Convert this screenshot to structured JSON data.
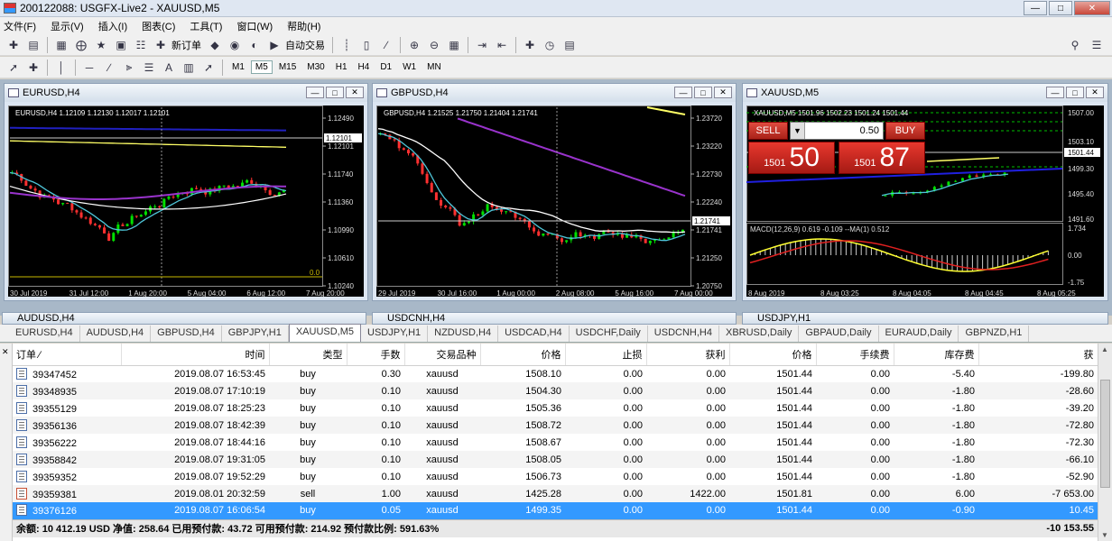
{
  "window": {
    "title": "200122088: USGFX-Live2 - XAUUSD,M5"
  },
  "menu": [
    "文件(F)",
    "显示(V)",
    "插入(I)",
    "图表(C)",
    "工具(T)",
    "窗口(W)",
    "帮助(H)"
  ],
  "toolbar": {
    "new_order": "新订单",
    "auto_trade": "自动交易"
  },
  "timeframes": [
    "M1",
    "M5",
    "M15",
    "M30",
    "H1",
    "H4",
    "D1",
    "W1",
    "MN"
  ],
  "active_timeframe": "M5",
  "charts": [
    {
      "title": "EURUSD,H4",
      "info": "EURUSD,H4  1.12109 1.12130 1.12017 1.12101",
      "price_labels": [
        "1.12490",
        "1.12101",
        "1.11740",
        "1.11360",
        "1.10990",
        "1.10610",
        "1.10240"
      ],
      "time_labels": [
        "30 Jul 2019",
        "31 Jul 12:00",
        "1 Aug 20:00",
        "5 Aug 04:00",
        "6 Aug 12:00",
        "7 Aug 20:00"
      ],
      "corner_value": "0.0"
    },
    {
      "title": "GBPUSD,H4",
      "info": "GBPUSD,H4  1.21525 1.21750 1.21404 1.21741",
      "price_labels": [
        "1.23720",
        "1.23220",
        "1.22730",
        "1.22240",
        "1.21741",
        "1.21250",
        "1.20750"
      ],
      "time_labels": [
        "29 Jul 2019",
        "30 Jul 16:00",
        "1 Aug 00:00",
        "2 Aug 08:00",
        "5 Aug 16:00",
        "7 Aug 00:00"
      ]
    },
    {
      "title": "XAUUSD,M5",
      "info": "XAUUSD,M5  1501.96 1502.23 1501.24 1501.44",
      "price_labels": [
        "1507.00",
        "1503.10",
        "1501.44",
        "1499.30",
        "1495.40",
        "1491.60"
      ],
      "macd_label": "MACD(12,26,9) 0.619 -0.109 --MA(1) 0.512",
      "macd_labels": [
        "1.734",
        "0.00",
        "-1.75"
      ],
      "time_labels": [
        "8 Aug 2019",
        "8 Aug 03:25",
        "8 Aug 04:05",
        "8 Aug 04:45",
        "8 Aug 05:25"
      ],
      "trade_panel": {
        "sell_label": "SELL",
        "buy_label": "BUY",
        "volume": "0.50",
        "sell_price_small": "1501",
        "sell_price_big": "50",
        "buy_price_small": "1501",
        "buy_price_big": "87"
      }
    }
  ],
  "background_windows": [
    "AUDUSD,H4",
    "USDCNH,H4",
    "USDJPY,H1"
  ],
  "tabs": [
    "EURUSD,H4",
    "AUDUSD,H4",
    "GBPUSD,H4",
    "GBPJPY,H1",
    "XAUUSD,M5",
    "USDJPY,H1",
    "NZDUSD,H4",
    "USDCAD,H4",
    "USDCHF,Daily",
    "USDCNH,H4",
    "XBRUSD,Daily",
    "GBPAUD,Daily",
    "EURAUD,Daily",
    "GBPNZD,H1"
  ],
  "active_tab": "XAUUSD,M5",
  "table": {
    "headers": [
      "订单",
      "时间",
      "类型",
      "手数",
      "交易品种",
      "价格",
      "止损",
      "获利",
      "价格",
      "手续费",
      "库存费",
      "获"
    ],
    "rows": [
      [
        "39347452",
        "2019.08.07 16:53:45",
        "buy",
        "0.30",
        "xauusd",
        "1508.10",
        "0.00",
        "0.00",
        "1501.44",
        "0.00",
        "-5.40",
        "-199.80"
      ],
      [
        "39348935",
        "2019.08.07 17:10:19",
        "buy",
        "0.10",
        "xauusd",
        "1504.30",
        "0.00",
        "0.00",
        "1501.44",
        "0.00",
        "-1.80",
        "-28.60"
      ],
      [
        "39355129",
        "2019.08.07 18:25:23",
        "buy",
        "0.10",
        "xauusd",
        "1505.36",
        "0.00",
        "0.00",
        "1501.44",
        "0.00",
        "-1.80",
        "-39.20"
      ],
      [
        "39356136",
        "2019.08.07 18:42:39",
        "buy",
        "0.10",
        "xauusd",
        "1508.72",
        "0.00",
        "0.00",
        "1501.44",
        "0.00",
        "-1.80",
        "-72.80"
      ],
      [
        "39356222",
        "2019.08.07 18:44:16",
        "buy",
        "0.10",
        "xauusd",
        "1508.67",
        "0.00",
        "0.00",
        "1501.44",
        "0.00",
        "-1.80",
        "-72.30"
      ],
      [
        "39358842",
        "2019.08.07 19:31:05",
        "buy",
        "0.10",
        "xauusd",
        "1508.05",
        "0.00",
        "0.00",
        "1501.44",
        "0.00",
        "-1.80",
        "-66.10"
      ],
      [
        "39359352",
        "2019.08.07 19:52:29",
        "buy",
        "0.10",
        "xauusd",
        "1506.73",
        "0.00",
        "0.00",
        "1501.44",
        "0.00",
        "-1.80",
        "-52.90"
      ],
      [
        "39359381",
        "2019.08.01 20:32:59",
        "sell",
        "1.00",
        "xauusd",
        "1425.28",
        "0.00",
        "1422.00",
        "1501.81",
        "0.00",
        "6.00",
        "-7 653.00"
      ],
      [
        "39376126",
        "2019.08.07 16:06:54",
        "buy",
        "0.05",
        "xauusd",
        "1499.35",
        "0.00",
        "0.00",
        "1501.44",
        "0.00",
        "-0.90",
        "10.45"
      ]
    ],
    "selected_row": 8,
    "summary": "余额: 10 412.19 USD  净值: 258.64  已用预付款: 43.72  可用预付款: 214.92  预付款比例: 591.63%",
    "summary_total": "-10 153.55"
  }
}
